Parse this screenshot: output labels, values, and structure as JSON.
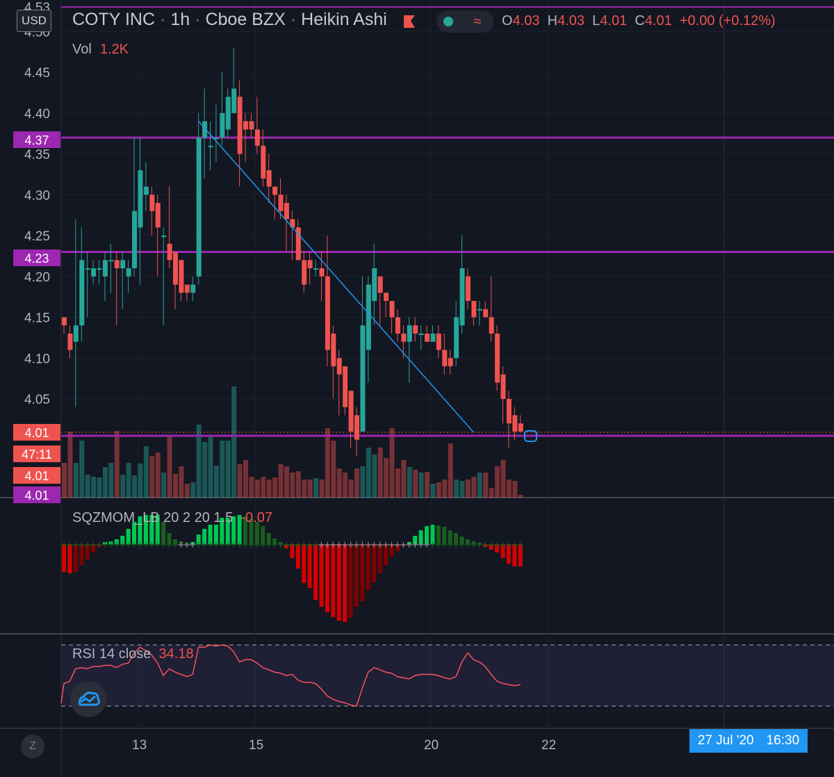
{
  "header": {
    "symbol": "COTY INC",
    "interval": "1h",
    "exchange": "Cboe BZX",
    "chart_style": "Heikin Ashi",
    "ohlc": {
      "o_label": "O",
      "o": "4.03",
      "h_label": "H",
      "h": "4.03",
      "l_label": "L",
      "l": "4.01",
      "c_label": "C",
      "c": "4.01",
      "change": "+0.00 (+0.12%)"
    },
    "volume_label": "Vol",
    "volume_value": "1.2K",
    "currency": "USD"
  },
  "indicators": {
    "sqz_label": "SQZMOM_LB 20 2 20 1.5",
    "sqz_value": "-0.07",
    "sqz_zero": "0.00",
    "rsi_label": "RSI 14 close",
    "rsi_value": "34.18"
  },
  "price_axis": {
    "ticks": [
      "4.53",
      "4.50",
      "4.45",
      "4.40",
      "4.35",
      "4.30",
      "4.25",
      "4.20",
      "4.15",
      "4.10",
      "4.05"
    ],
    "tags": [
      {
        "text": "4.37",
        "kind": "level"
      },
      {
        "text": "4.23",
        "kind": "level"
      },
      {
        "text": "4.01",
        "kind": "last"
      },
      {
        "text": "47:11",
        "kind": "countdown"
      },
      {
        "text": "4.01",
        "kind": "last"
      },
      {
        "text": "4.01",
        "kind": "level"
      }
    ]
  },
  "time_axis": {
    "ticks": [
      "13",
      "15",
      "20",
      "22"
    ],
    "crosshair_date": "27 Jul '20",
    "crosshair_time": "16:30",
    "reset_button": "Z"
  },
  "colors": {
    "bg": "#131722",
    "up": "#26a69a",
    "down": "#ef5350",
    "level": "#9c27b0",
    "trend": "#2196f3",
    "rsi": "#f7525f",
    "sqz_green": "#00c853",
    "sqz_dark_green": "#1b5e20",
    "sqz_red": "#d50000",
    "sqz_dark_red": "#7f0000"
  },
  "chart_data": {
    "type": "candlestick",
    "style": "Heikin Ashi",
    "ylim": [
      4.0,
      4.53
    ],
    "horizontal_levels": [
      4.37,
      4.23,
      4.01
    ],
    "trendline": {
      "from": {
        "index": 23,
        "price": 4.39
      },
      "to": {
        "index": 70,
        "price": 4.01
      }
    },
    "candles": [
      [
        4.15,
        4.14,
        4.15,
        4.13
      ],
      [
        4.13,
        4.11,
        4.14,
        4.1
      ],
      [
        4.12,
        4.14,
        4.27,
        4.04
      ],
      [
        4.14,
        4.22,
        4.26,
        4.12
      ],
      [
        4.21,
        4.21,
        4.23,
        4.15
      ],
      [
        4.2,
        4.21,
        4.22,
        4.19
      ],
      [
        4.21,
        4.21,
        4.22,
        4.19
      ],
      [
        4.2,
        4.22,
        4.23,
        4.17
      ],
      [
        4.22,
        4.22,
        4.24,
        4.18
      ],
      [
        4.22,
        4.21,
        4.23,
        4.14
      ],
      [
        4.21,
        4.22,
        4.23,
        4.16
      ],
      [
        4.2,
        4.21,
        4.22,
        4.18
      ],
      [
        4.21,
        4.28,
        4.37,
        4.2
      ],
      [
        4.26,
        4.33,
        4.37,
        4.19
      ],
      [
        4.3,
        4.31,
        4.34,
        4.28
      ],
      [
        4.3,
        4.28,
        4.31,
        4.25
      ],
      [
        4.29,
        4.26,
        4.3,
        4.2
      ],
      [
        4.25,
        4.25,
        4.26,
        4.14
      ],
      [
        4.24,
        4.22,
        4.31,
        4.21
      ],
      [
        4.23,
        4.19,
        4.23,
        4.16
      ],
      [
        4.22,
        4.18,
        4.22,
        4.17
      ],
      [
        4.19,
        4.18,
        4.19,
        4.17
      ],
      [
        4.18,
        4.19,
        4.2,
        4.17
      ],
      [
        4.2,
        4.37,
        4.4,
        4.19
      ],
      [
        4.37,
        4.39,
        4.43,
        4.32
      ],
      [
        4.36,
        4.36,
        4.39,
        4.33
      ],
      [
        4.37,
        4.37,
        4.41,
        4.34
      ],
      [
        4.37,
        4.4,
        4.45,
        4.36
      ],
      [
        4.38,
        4.42,
        4.43,
        4.37
      ],
      [
        4.4,
        4.43,
        4.48,
        4.4
      ],
      [
        4.42,
        4.35,
        4.44,
        4.31
      ],
      [
        4.39,
        4.38,
        4.4,
        4.34
      ],
      [
        4.39,
        4.38,
        4.4,
        4.37
      ],
      [
        4.38,
        4.36,
        4.42,
        4.35
      ],
      [
        4.36,
        4.32,
        4.38,
        4.31
      ],
      [
        4.33,
        4.31,
        4.35,
        4.29
      ],
      [
        4.31,
        4.3,
        4.31,
        4.27
      ],
      [
        4.3,
        4.28,
        4.32,
        4.27
      ],
      [
        4.29,
        4.27,
        4.3,
        4.23
      ],
      [
        4.27,
        4.26,
        4.28,
        4.22
      ],
      [
        4.26,
        4.22,
        4.27,
        4.22
      ],
      [
        4.22,
        4.19,
        4.23,
        4.18
      ],
      [
        4.22,
        4.21,
        4.23,
        4.19
      ],
      [
        4.21,
        4.21,
        4.22,
        4.2
      ],
      [
        4.21,
        4.2,
        4.23,
        4.17
      ],
      [
        4.2,
        4.11,
        4.25,
        4.09
      ],
      [
        4.13,
        4.09,
        4.14,
        4.05
      ],
      [
        4.1,
        4.08,
        4.11,
        4.03
      ],
      [
        4.09,
        4.04,
        4.09,
        4.03
      ],
      [
        4.06,
        4.01,
        4.06,
        3.99
      ],
      [
        4.03,
        4.0,
        4.04,
        3.98
      ],
      [
        4.01,
        4.14,
        4.2,
        4.01
      ],
      [
        4.11,
        4.19,
        4.2,
        4.07
      ],
      [
        4.17,
        4.21,
        4.24,
        4.14
      ],
      [
        4.2,
        4.18,
        4.2,
        4.14
      ],
      [
        4.18,
        4.17,
        4.18,
        4.15
      ],
      [
        4.17,
        4.15,
        4.17,
        4.13
      ],
      [
        4.15,
        4.13,
        4.16,
        4.12
      ],
      [
        4.13,
        4.12,
        4.14,
        4.1
      ],
      [
        4.12,
        4.14,
        4.15,
        4.07
      ],
      [
        4.14,
        4.13,
        4.15,
        4.12
      ],
      [
        4.13,
        4.13,
        4.14,
        4.11
      ],
      [
        4.13,
        4.12,
        4.14,
        4.12
      ],
      [
        4.12,
        4.13,
        4.14,
        4.12
      ],
      [
        4.13,
        4.11,
        4.14,
        4.1
      ],
      [
        4.11,
        4.09,
        4.13,
        4.08
      ],
      [
        4.1,
        4.09,
        4.11,
        4.08
      ],
      [
        4.1,
        4.15,
        4.17,
        4.09
      ],
      [
        4.14,
        4.21,
        4.25,
        4.13
      ],
      [
        4.2,
        4.17,
        4.21,
        4.16
      ],
      [
        4.17,
        4.15,
        4.17,
        4.14
      ],
      [
        4.16,
        4.16,
        4.17,
        4.14
      ],
      [
        4.16,
        4.15,
        4.17,
        4.15
      ],
      [
        4.15,
        4.13,
        4.2,
        4.12
      ],
      [
        4.13,
        4.07,
        4.14,
        4.06
      ],
      [
        4.08,
        4.05,
        4.09,
        4.02
      ],
      [
        4.05,
        4.02,
        4.06,
        3.99
      ],
      [
        4.03,
        4.01,
        4.04,
        4.0
      ],
      [
        4.02,
        4.01,
        4.03,
        4.01
      ]
    ],
    "volume": [
      50,
      95,
      50,
      82,
      33,
      30,
      29,
      44,
      50,
      96,
      33,
      50,
      32,
      49,
      74,
      60,
      65,
      36,
      88,
      34,
      45,
      20,
      22,
      105,
      80,
      88,
      46,
      82,
      82,
      160,
      48,
      54,
      30,
      26,
      30,
      26,
      29,
      48,
      45,
      36,
      38,
      26,
      26,
      28,
      26,
      100,
      82,
      42,
      36,
      26,
      42,
      45,
      72,
      62,
      72,
      57,
      100,
      42,
      54,
      44,
      40,
      36,
      37,
      20,
      22,
      26,
      78,
      26,
      24,
      26,
      30,
      36,
      36,
      14,
      45,
      54,
      26,
      24,
      4
    ],
    "sqzmom": [
      -40,
      -42,
      -40,
      -30,
      -22,
      -12,
      -4,
      3,
      4,
      7,
      12,
      22,
      32,
      40,
      42,
      42,
      42,
      32,
      16,
      7,
      4,
      2,
      3,
      14,
      22,
      28,
      28,
      38,
      38,
      40,
      42,
      40,
      36,
      32,
      26,
      16,
      8,
      3,
      -6,
      -20,
      -35,
      -56,
      -63,
      -80,
      -90,
      -98,
      -105,
      -110,
      -112,
      -106,
      -90,
      -82,
      -66,
      -55,
      -42,
      -30,
      -18,
      -10,
      -3,
      3,
      12,
      20,
      26,
      28,
      27,
      25,
      20,
      16,
      11,
      7,
      4,
      2,
      -4,
      -8,
      -12,
      -20,
      -28,
      -32,
      -32
    ],
    "rsi": [
      34,
      36,
      47,
      48,
      47,
      49,
      49,
      50,
      50,
      48,
      51,
      52,
      61,
      66,
      63,
      59,
      52,
      41,
      47,
      44,
      42,
      40,
      42,
      66,
      66,
      68,
      67,
      68,
      67,
      62,
      53,
      55,
      55,
      52,
      48,
      46,
      44,
      43,
      41,
      42,
      37,
      35,
      35,
      34,
      29,
      23,
      20,
      18,
      17,
      15,
      14,
      30,
      44,
      48,
      46,
      44,
      43,
      40,
      39,
      38,
      41,
      42,
      42,
      42,
      41,
      39,
      38,
      40,
      53,
      61,
      55,
      53,
      49,
      42,
      36,
      34,
      33,
      32,
      33
    ]
  }
}
